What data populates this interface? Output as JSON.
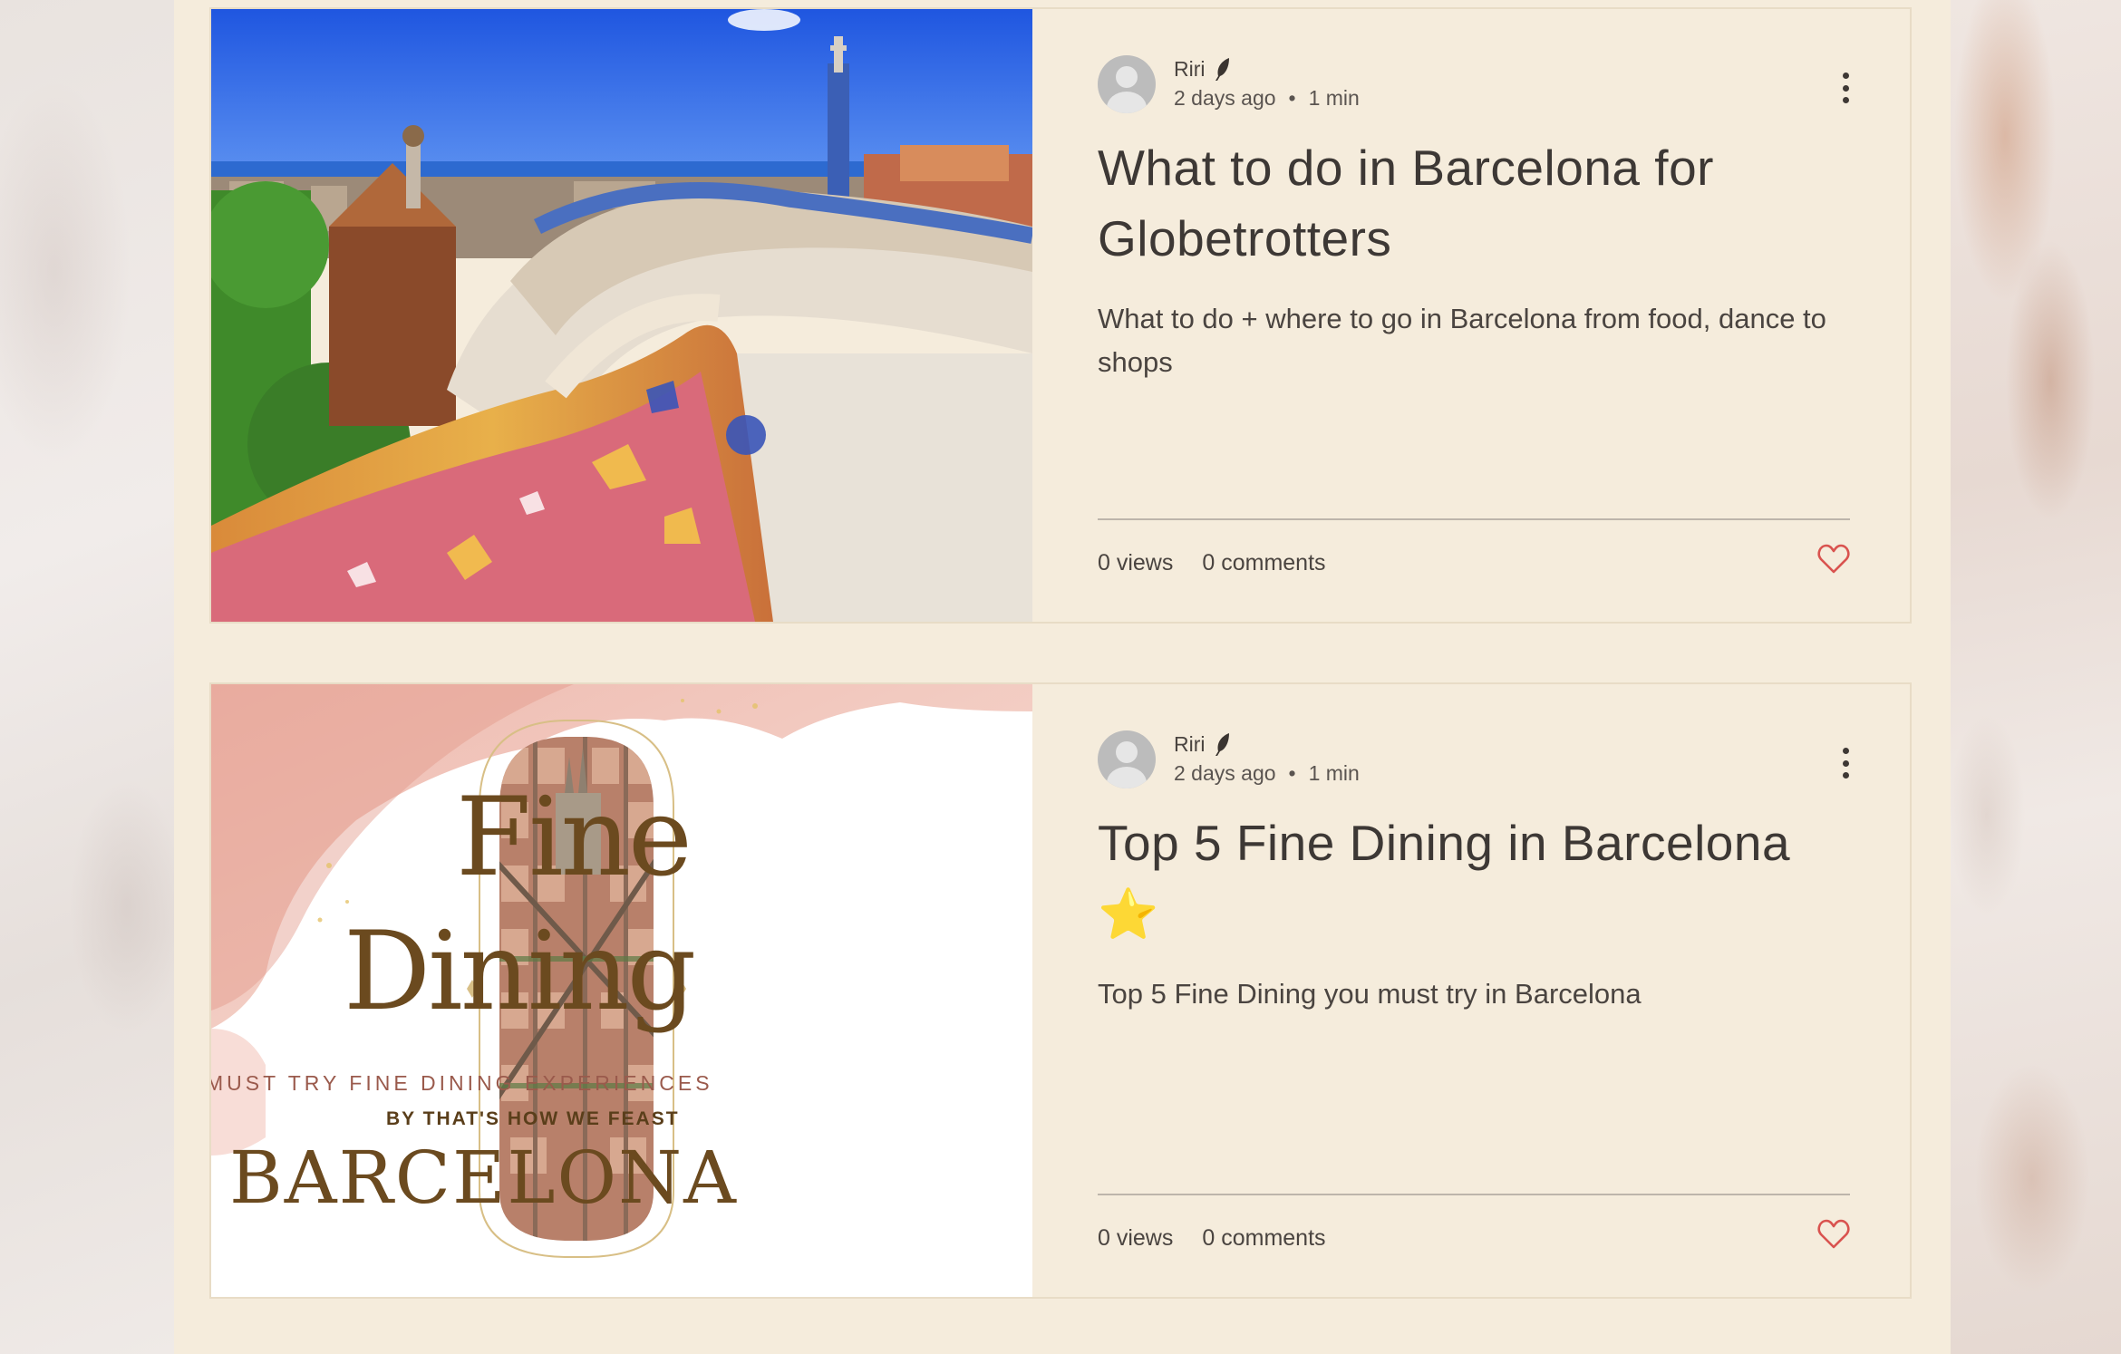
{
  "posts": [
    {
      "author": "Riri",
      "date": "2 days ago",
      "read_time": "1 min",
      "title": "What to do in Barcelona for Globetrotters",
      "excerpt": "What to do + where to go in Barcelona from food, dance to shops",
      "views": "0 views",
      "comments": "0 comments",
      "image_alt": "Park Güell mosaic bench overlooking Barcelona"
    },
    {
      "author": "Riri",
      "date": "2 days ago",
      "read_time": "1 min",
      "title": "Top 5 Fine Dining in Barcelona",
      "title_emoji": "⭐",
      "excerpt": "Top 5 Fine Dining you must try in Barcelona",
      "views": "0 views",
      "comments": "0 comments",
      "image": {
        "line1": "Fine",
        "line2": "Dining",
        "subtitle": "MUST TRY FINE DINING EXPERIENCES",
        "byline": "BY THAT'S HOW WE FEAST",
        "city": "BARCELONA"
      }
    }
  ],
  "colors": {
    "card_bg": "#f5ecdc",
    "text": "#3d3835",
    "heart": "#d9534f"
  }
}
